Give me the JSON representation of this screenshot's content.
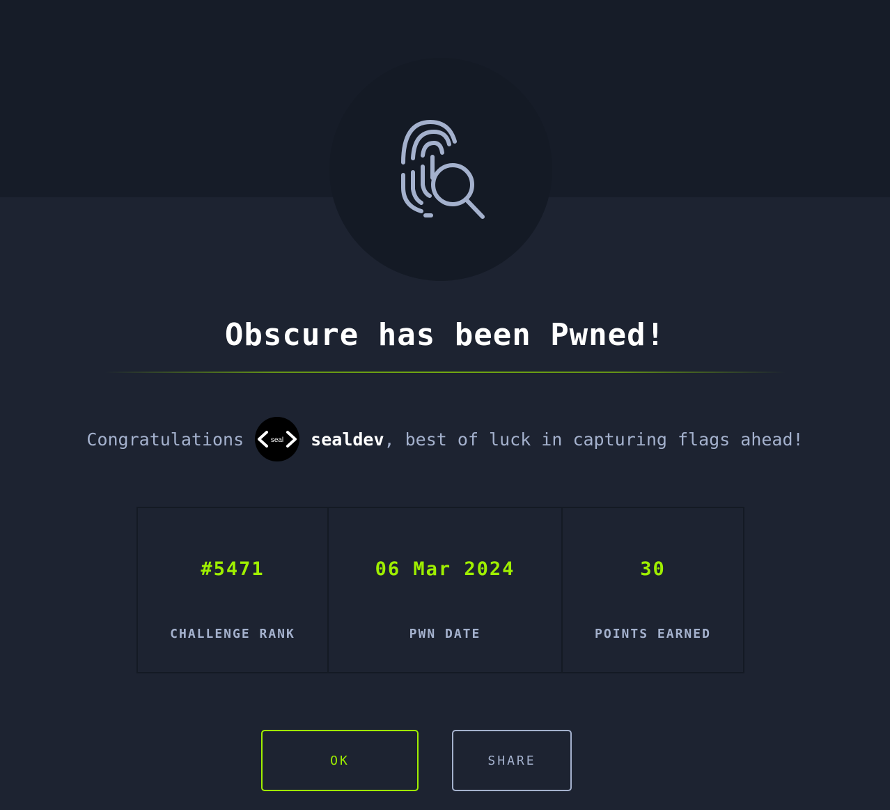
{
  "modal": {
    "title": "Obscure has been Pwned!",
    "congrats_prefix": "Congratulations",
    "username": "sealdev",
    "congrats_suffix": ", best of luck in capturing flags ahead!",
    "avatar_text": "seal",
    "icon": "fingerprint-search-icon"
  },
  "stats": [
    {
      "value": "#5471",
      "label": "CHALLENGE RANK"
    },
    {
      "value": "06 Mar 2024",
      "label": "PWN DATE"
    },
    {
      "value": "30",
      "label": "POINTS EARNED"
    }
  ],
  "buttons": {
    "ok_label": "OK",
    "share_label": "SHARE"
  },
  "colors": {
    "accent": "#9fef00",
    "muted_text": "#a4b1cd",
    "background": "#1d2331",
    "band": "#161c28"
  }
}
